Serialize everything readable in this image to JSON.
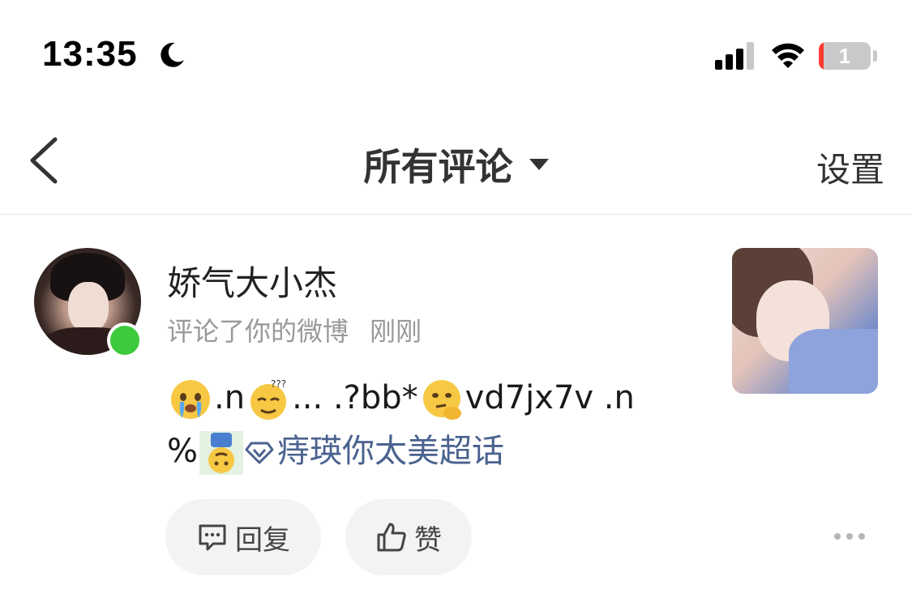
{
  "status_bar": {
    "time": "13:35",
    "battery_level": "1",
    "battery_fraction": 0.01,
    "icons": [
      "moon-icon",
      "signal-icon",
      "wifi-icon",
      "battery-icon"
    ]
  },
  "nav": {
    "back_icon": "chevron-left-icon",
    "title": "所有评论",
    "dropdown_icon": "caret-down-icon",
    "settings_label": "设置"
  },
  "notification": {
    "username": "娇气大小杰",
    "action": "评论了你的微博",
    "time_ago": "刚刚",
    "online": true,
    "comment": {
      "seg1": ".n",
      "seg2": "... .?bb*",
      "seg3": "vd7jx7v .n",
      "seg4": "%",
      "topic": "痔瑛你太美超话",
      "emoji": [
        "crying-emoji",
        "dizzy-emoji",
        "thinking-emoji",
        "upside-down-emoji"
      ]
    },
    "reply_label": "回复",
    "like_label": "赞",
    "colors": {
      "topic_link": "#4a628f",
      "online_dot": "#3ccb3c"
    }
  }
}
